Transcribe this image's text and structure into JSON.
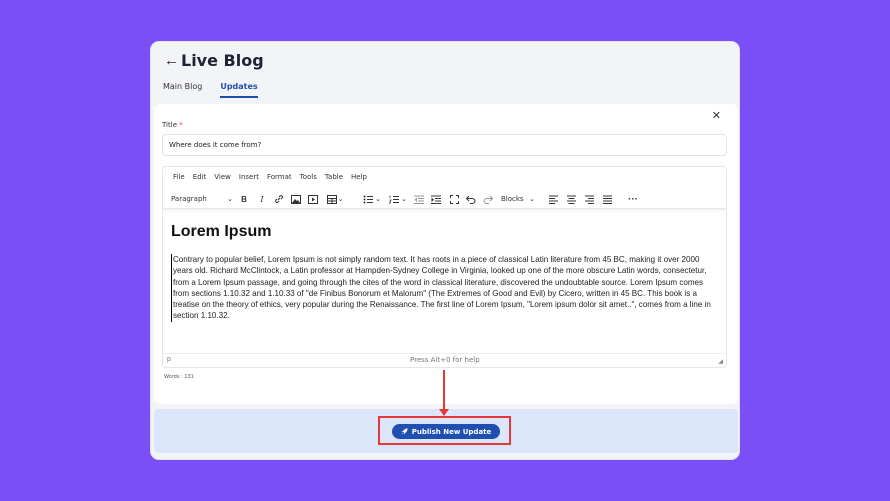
{
  "header": {
    "back_icon": "←",
    "title": "Live Blog",
    "tabs": [
      {
        "label": "Main Blog",
        "active": false
      },
      {
        "label": "Updates",
        "active": true
      }
    ]
  },
  "form": {
    "close_icon": "✕",
    "title_label": "Title",
    "required_mark": "*",
    "title_value": "Where does it come from?"
  },
  "editor": {
    "menu": [
      "File",
      "Edit",
      "View",
      "Insert",
      "Format",
      "Tools",
      "Table",
      "Help"
    ],
    "toolbar": {
      "paragraph_select": "Paragraph",
      "blocks_select": "Blocks"
    },
    "content": {
      "heading": "Lorem Ipsum",
      "paragraph": "Contrary to popular belief, Lorem Ipsum is not simply random text. It has roots in a piece of classical Latin literature from 45 BC, making it over 2000 years old. Richard McClintock, a Latin professor at Hampden-Sydney College in Virginia, looked up one of the more obscure Latin words, consectetur, from a Lorem Ipsum passage, and going through the cites of the word in classical literature, discovered the undoubtable source. Lorem Ipsum comes from sections 1.10.32 and 1.10.33 of \"de Finibus Bonorum et Malorum\" (The Extremes of Good and Evil) by Cicero, written in 45 BC. This book is a treatise on the theory of ethics, very popular during the Renaissance. The first line of Lorem Ipsum, \"Lorem ipsum dolor sit amet..\", comes from a line in section 1.10.32."
    },
    "status": {
      "path": "p",
      "help": "Press Alt+0 for help"
    },
    "word_count": "Words : 131"
  },
  "footer": {
    "publish_label": "Publish New Update",
    "publish_icon": "rocket-icon"
  },
  "colors": {
    "background": "#7a4ff6",
    "accent": "#1f4fb0",
    "highlight": "#e53935",
    "footer_bg": "#dbe6fb"
  }
}
